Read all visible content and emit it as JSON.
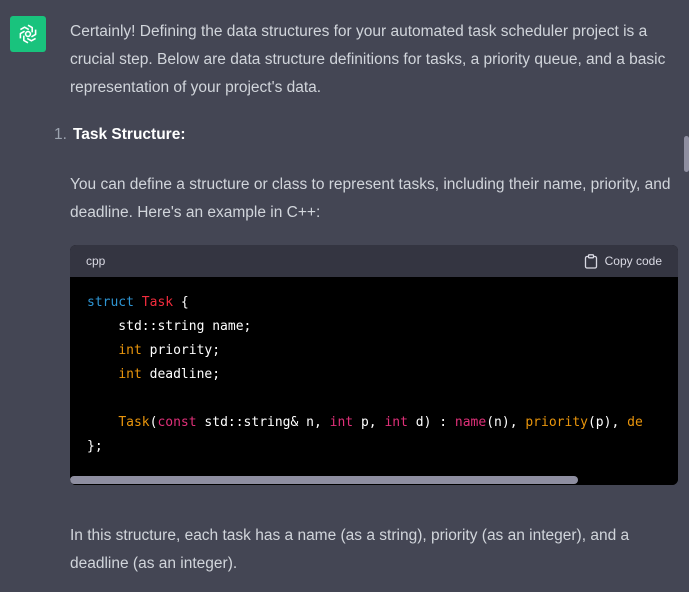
{
  "message": {
    "intro": "Certainly! Defining the data structures for your automated task scheduler project is a crucial step. Below are data structure definitions for tasks, a priority queue, and a basic representation of your project's data.",
    "list_number": "1.",
    "list_title": "Task Structure:",
    "paragraph2": "You can define a structure or class to represent tasks, including their name, priority, and deadline. Here's an example in C++:",
    "paragraph3": "In this structure, each task has a name (as a string), priority (as an integer), and a deadline (as an integer)."
  },
  "code": {
    "language": "cpp",
    "copy_label": "Copy code",
    "line1": {
      "kw": "struct",
      "name": "Task",
      "rest": " {"
    },
    "line2": "    std::string name;",
    "line3": {
      "indent": "    ",
      "type": "int",
      "rest": " priority;"
    },
    "line4": {
      "indent": "    ",
      "type": "int",
      "rest": " deadline;"
    },
    "line6": {
      "indent": "    ",
      "ctor": "Task",
      "open": "(",
      "const_kw": "const",
      "p1": " std::string& n, ",
      "int1": "int",
      "p2": " p, ",
      "int2": "int",
      "p3": " d) : ",
      "init1": "name",
      "a1": "(n), ",
      "init2": "priority",
      "a2": "(p), ",
      "init3": "de"
    },
    "line7": "};"
  },
  "colors": {
    "background": "#444654",
    "avatar": "#19c37d",
    "code_bg": "#000000",
    "code_header": "#343541"
  },
  "icons": {
    "avatar": "openai-logo-icon",
    "copy": "clipboard-icon"
  }
}
